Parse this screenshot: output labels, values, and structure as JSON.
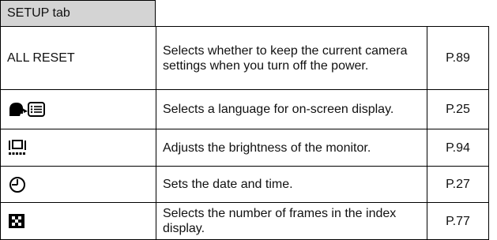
{
  "table": {
    "header": "SETUP tab",
    "rows": [
      {
        "label": "ALL RESET",
        "icon": null,
        "description": "Selects whether to keep the current camera settings when you turn off the power.",
        "page": "P.89"
      },
      {
        "label": "",
        "icon": "language-icon",
        "description": "Selects a language for on-screen display.",
        "page": "P.25"
      },
      {
        "label": "",
        "icon": "monitor-brightness-icon",
        "description": "Adjusts the brightness of the monitor.",
        "page": "P.94"
      },
      {
        "label": "",
        "icon": "clock-icon",
        "description": "Sets the date and time.",
        "page": "P.27"
      },
      {
        "label": "",
        "icon": "index-display-icon",
        "description": "Selects the number of frames in the index display.",
        "page": "P.77"
      }
    ]
  }
}
